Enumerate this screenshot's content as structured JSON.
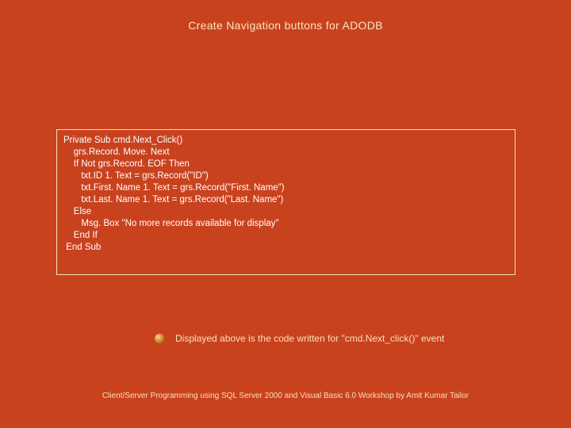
{
  "title": "Create Navigation buttons for ADODB",
  "code": "Private Sub cmd.Next_Click()\n    grs.Record. Move. Next\n    If Not grs.Record. EOF Then\n       txt.ID 1. Text = grs.Record(\"ID\")\n       txt.First. Name 1. Text = grs.Record(\"First. Name\")\n       txt.Last. Name 1. Text = grs.Record(\"Last. Name\")\n    Else\n       Msg. Box \"No more records available for display\"\n    End If\n End Sub",
  "bullet": {
    "text": "Displayed above is the code written for \"cmd.Next_click()\" event"
  },
  "footer": "Client/Server Programming using SQL Server 2000 and Visual Basic 6.0 Workshop by Amit Kumar Tailor"
}
